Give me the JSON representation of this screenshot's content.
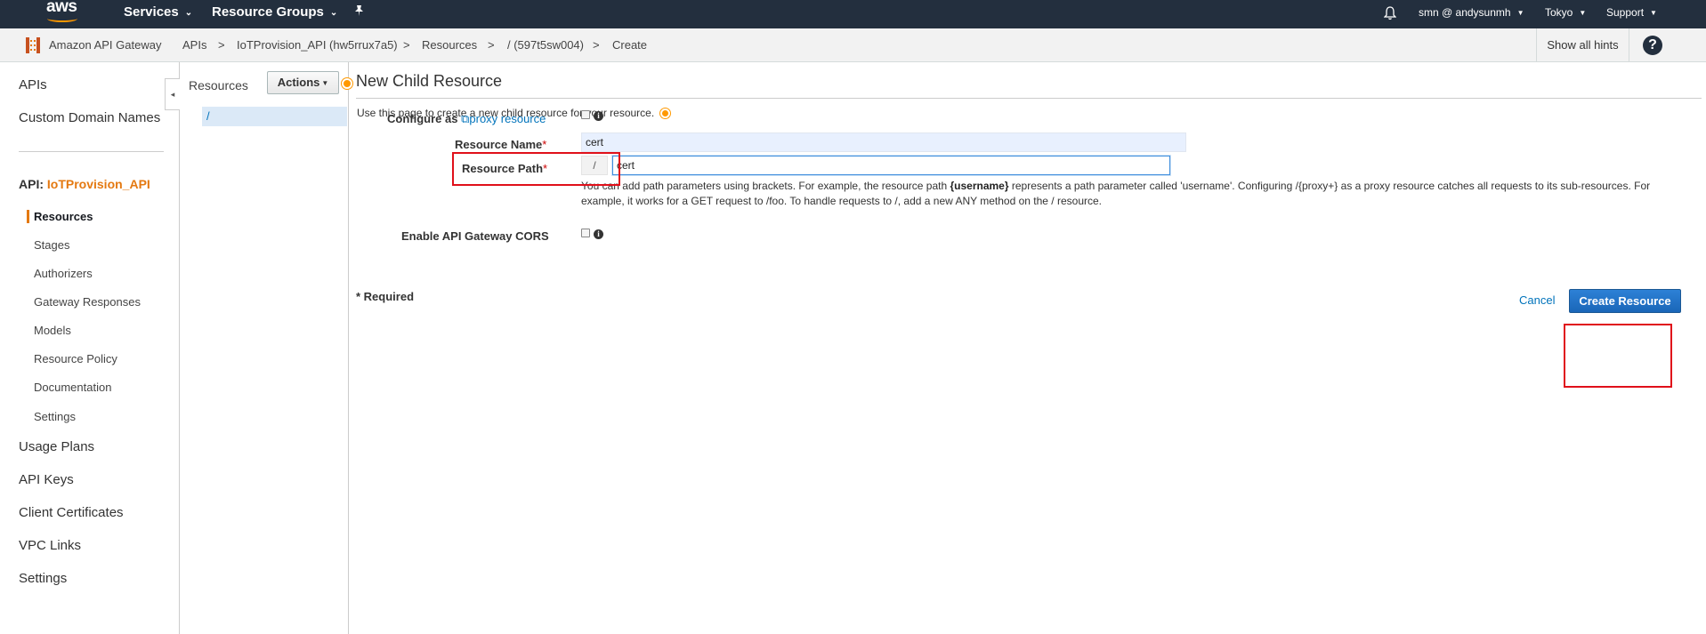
{
  "topnav": {
    "logo_text": "aws",
    "services": "Services",
    "resource_groups": "Resource Groups",
    "pin_icon": "pin-icon",
    "user": "smn @ andysunmh",
    "region": "Tokyo",
    "support": "Support"
  },
  "breadcrumb": {
    "service": "Amazon API Gateway",
    "items": [
      "APIs",
      "IoTProvision_API (hw5rrux7a5)",
      "Resources",
      "/ (597t5sw004)",
      "Create"
    ],
    "separator": ">",
    "show_hints": "Show all hints",
    "help": "?"
  },
  "sidebar": {
    "top_items": [
      "APIs",
      "Custom Domain Names"
    ],
    "api_prefix": "API:",
    "api_name": "IoTProvision_API",
    "sub_items": [
      "Resources",
      "Stages",
      "Authorizers",
      "Gateway Responses",
      "Models",
      "Resource Policy",
      "Documentation",
      "Settings"
    ],
    "bottom_items": [
      "Usage Plans",
      "API Keys",
      "Client Certificates",
      "VPC Links",
      "Settings"
    ],
    "collapse_icon": "◂"
  },
  "resources_panel": {
    "title": "Resources",
    "actions_label": "Actions",
    "root": "/"
  },
  "main": {
    "heading": "New Child Resource",
    "intro": "Use this page to create a new child resource for your resource.",
    "configure_label": "Configure as",
    "proxy_link": "proxy resource",
    "resource_name_label": "Resource Name",
    "resource_name_value": "cert",
    "resource_path_label": "Resource Path",
    "resource_path_prefix": "/",
    "resource_path_value": "cert",
    "help_part1": "You can add path parameters using brackets. For example, the resource path ",
    "help_bold": "{username}",
    "help_part2": " represents a path parameter called 'username'. Configuring /{proxy+} as a proxy resource catches all requests to its sub-resources. For example, it works for a GET request to /foo. To handle requests to /, add a new ANY method on the / resource.",
    "cors_label": "Enable API Gateway CORS",
    "required_note": "* Required",
    "required_mark": "*",
    "cancel": "Cancel",
    "create_button": "Create Resource"
  },
  "colors": {
    "nav_bg": "#232f3e",
    "accent_orange": "#ff9900",
    "link_blue": "#0073bb",
    "highlight_red": "#e0101a",
    "primary_button": "#1a66b8"
  }
}
